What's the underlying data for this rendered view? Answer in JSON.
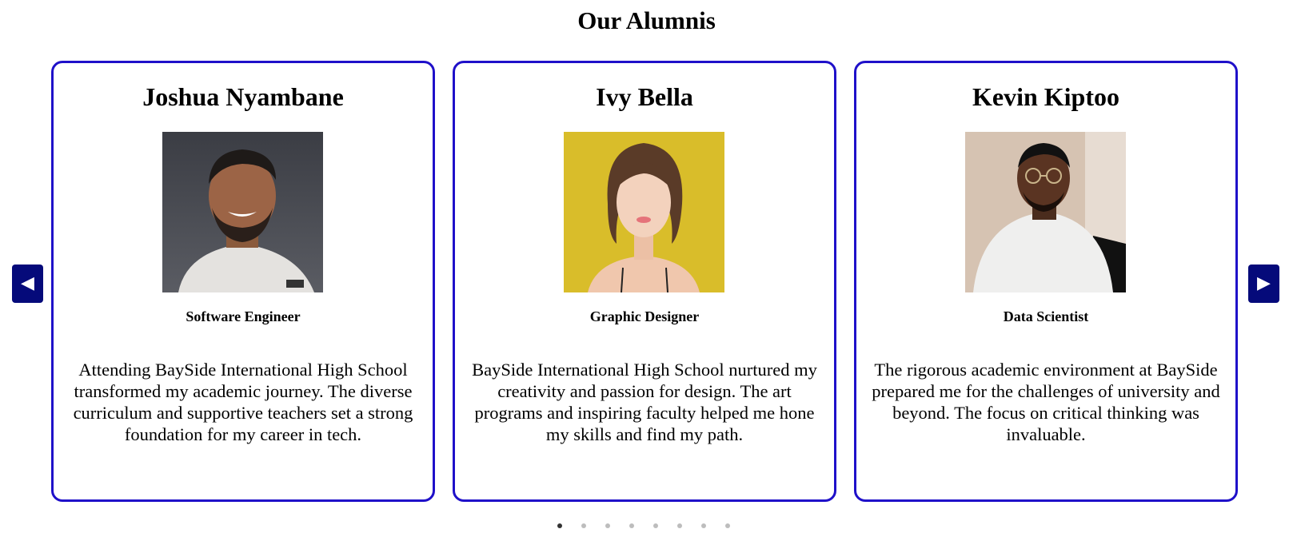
{
  "section": {
    "title": "Our Alumnis"
  },
  "carousel": {
    "prev_icon": "◀",
    "next_icon": "▶",
    "cards": [
      {
        "name": "Joshua Nyambane",
        "role": "Software Engineer",
        "quote": "Attending BaySide International High School transformed my academic journey. The diverse curriculum and supportive teachers set a strong foundation for my career in tech."
      },
      {
        "name": "Ivy Bella",
        "role": "Graphic Designer",
        "quote": "BaySide International High School nurtured my creativity and passion for design. The art programs and inspiring faculty helped me hone my skills and find my path."
      },
      {
        "name": "Kevin Kiptoo",
        "role": "Data Scientist",
        "quote": "The rigorous academic environment at BaySide prepared me for the challenges of university and beyond. The focus on critical thinking was invaluable."
      }
    ],
    "dots_count": 8,
    "active_dot": 0
  },
  "colors": {
    "card_border": "#1f10c9",
    "nav_button": "#050a7a",
    "dot_active": "#333333",
    "dot_inactive": "#bdbdbd"
  }
}
